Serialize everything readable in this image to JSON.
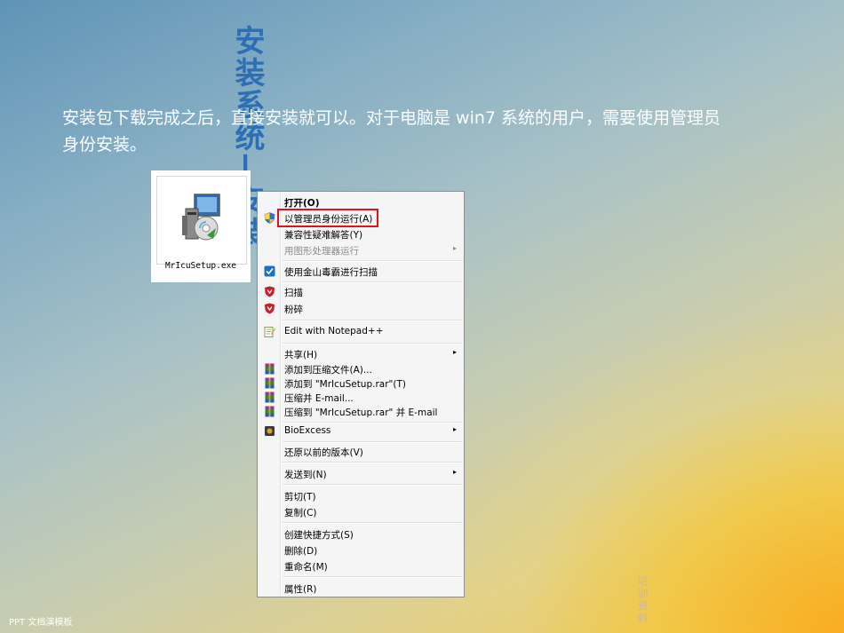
{
  "slide": {
    "title": "安装系统—安装",
    "description": "安装包下载完成之后，直接安装就可以。对于电脑是 win7 系统的用户，需要使用管理员身份安装。",
    "footer": "PPT 文档演模板",
    "watermark": "培训资料"
  },
  "file": {
    "name": "MrIcuSetup.exe",
    "icon": "installer-icon"
  },
  "menu": {
    "highlight_color": "#e0121a",
    "items": [
      {
        "label": "打开(O)",
        "icon": ""
      },
      {
        "label": "以管理员身份运行(A)",
        "icon": "uac-shield-icon"
      },
      {
        "label": "兼容性疑难解答(Y)",
        "icon": ""
      },
      {
        "label": "用图形处理器运行",
        "icon": "",
        "submenu": true,
        "disabled": true
      },
      {
        "label": "使用金山毒霸进行扫描",
        "icon": "kingsoft-icon"
      },
      {
        "label": "扫描",
        "icon": "antivirus-icon"
      },
      {
        "label": "粉碎",
        "icon": "antivirus-icon"
      },
      {
        "label": "Edit with Notepad++",
        "icon": "notepad-icon"
      },
      {
        "label": "共享(H)",
        "icon": "",
        "submenu": true
      },
      {
        "label": "添加到压缩文件(A)...",
        "icon": "winrar-icon"
      },
      {
        "label": "添加到 \"MrIcuSetup.rar\"(T)",
        "icon": "winrar-icon"
      },
      {
        "label": "压缩并 E-mail...",
        "icon": "winrar-icon"
      },
      {
        "label": "压缩到 \"MrIcuSetup.rar\" 并 E-mail",
        "icon": "winrar-icon"
      },
      {
        "label": "BioExcess",
        "icon": "bioexcess-icon",
        "submenu": true
      },
      {
        "label": "还原以前的版本(V)",
        "icon": ""
      },
      {
        "label": "发送到(N)",
        "icon": "",
        "submenu": true
      },
      {
        "label": "剪切(T)",
        "icon": ""
      },
      {
        "label": "复制(C)",
        "icon": ""
      },
      {
        "label": "创建快捷方式(S)",
        "icon": ""
      },
      {
        "label": "删除(D)",
        "icon": ""
      },
      {
        "label": "重命名(M)",
        "icon": ""
      },
      {
        "label": "属性(R)",
        "icon": ""
      }
    ],
    "arrow": "▸"
  }
}
